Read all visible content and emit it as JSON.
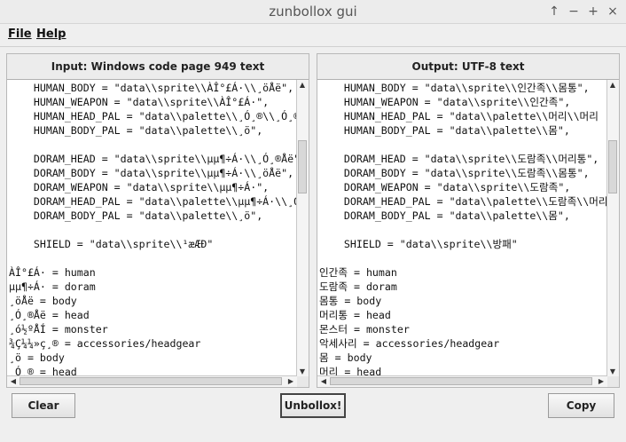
{
  "window": {
    "title": "zunbollox gui",
    "controls": [
      "↑",
      "−",
      "+",
      "×"
    ]
  },
  "menubar": {
    "file": "File",
    "help": "Help"
  },
  "input_panel": {
    "header": "Input: Windows code page 949 text",
    "lines": [
      "    HUMAN_BODY = \"data\\\\sprite\\\\ÀÎ°£Á·\\\\¸öÅë\",",
      "    HUMAN_WEAPON = \"data\\\\sprite\\\\ÀÎ°£Á·\",",
      "    HUMAN_HEAD_PAL = \"data\\\\palette\\\\¸Ó¸®\\\\¸Ó¸®",
      "    HUMAN_BODY_PAL = \"data\\\\palette\\\\¸ö\",",
      "",
      "    DORAM_HEAD = \"data\\\\sprite\\\\µµ¶÷Á·\\\\¸Ó¸®Åë\"",
      "    DORAM_BODY = \"data\\\\sprite\\\\µµ¶÷Á·\\\\¸öÅë\",",
      "    DORAM_WEAPON = \"data\\\\sprite\\\\µµ¶÷Á·\",",
      "    DORAM_HEAD_PAL = \"data\\\\palette\\\\µµ¶÷Á·\\\\¸Ó",
      "    DORAM_BODY_PAL = \"data\\\\palette\\\\¸ö\",",
      "",
      "    SHIELD = \"data\\\\sprite\\\\¹æÆÐ\"",
      "",
      "ÀÎ°£Á· = human",
      "µµ¶÷Á· = doram",
      "¸öÅë = body",
      "¸Ó¸®Åë = head",
      "¸ó½ºÅÍ = monster",
      "¾Ç¼¼»ç¸® = accessories/headgear",
      "¸ö = body",
      "¸Ó¸® = head"
    ]
  },
  "output_panel": {
    "header": "Output: UTF-8 text",
    "lines": [
      "    HUMAN_BODY = \"data\\\\sprite\\\\인간족\\\\몸통\",",
      "    HUMAN_WEAPON = \"data\\\\sprite\\\\인간족\",",
      "    HUMAN_HEAD_PAL = \"data\\\\palette\\\\머리\\\\머리",
      "    HUMAN_BODY_PAL = \"data\\\\palette\\\\몸\",",
      "",
      "    DORAM_HEAD = \"data\\\\sprite\\\\도람족\\\\머리통\",",
      "    DORAM_BODY = \"data\\\\sprite\\\\도람족\\\\몸통\",",
      "    DORAM_WEAPON = \"data\\\\sprite\\\\도람족\",",
      "    DORAM_HEAD_PAL = \"data\\\\palette\\\\도람족\\\\머리",
      "    DORAM_BODY_PAL = \"data\\\\palette\\\\몸\",",
      "",
      "    SHIELD = \"data\\\\sprite\\\\방패\"",
      "",
      "인간족 = human",
      "도람족 = doram",
      "몸통 = body",
      "머리통 = head",
      "몬스터 = monster",
      "악세사리 = accessories/headgear",
      "몸 = body",
      "머리 = head"
    ]
  },
  "buttons": {
    "clear": "Clear",
    "unbollox": "Unbollox!",
    "copy": "Copy"
  }
}
